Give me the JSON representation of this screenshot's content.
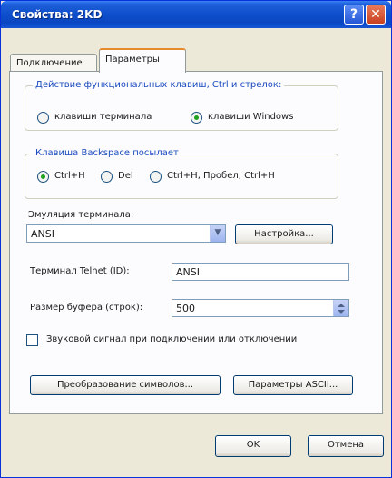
{
  "window": {
    "title": "Свойства: 2KD"
  },
  "titlebar": {
    "help_label": "?",
    "close_label": "✕"
  },
  "tabs": [
    {
      "label": "Подключение"
    },
    {
      "label": "Параметры"
    }
  ],
  "function_keys": {
    "legend": "Действие функциональных клавиш, Ctrl и стрелок:",
    "options": [
      {
        "label": "клавиши терминала",
        "selected": false
      },
      {
        "label": "клавиши Windows",
        "selected": true
      }
    ]
  },
  "backspace": {
    "legend": "Клавиша Backspace посылает",
    "options": [
      {
        "label": "Ctrl+H",
        "selected": true
      },
      {
        "label": "Del",
        "selected": false
      },
      {
        "label": "Ctrl+H, Пробел, Ctrl+H",
        "selected": false
      }
    ]
  },
  "emulation": {
    "label": "Эмуляция терминала:",
    "value": "ANSI",
    "setup_button": "Настройка..."
  },
  "telnet_id": {
    "label": "Терминал Telnet (ID):",
    "value": "ANSI"
  },
  "buffer": {
    "label": "Размер буфера (строк):",
    "value": "500"
  },
  "sound": {
    "label": "Звуковой сигнал при подключении или отключении",
    "checked": false
  },
  "buttons": {
    "char_translation": "Преобразование символов...",
    "ascii_params": "Параметры ASCII...",
    "ok": "OK",
    "cancel": "Отмена"
  }
}
